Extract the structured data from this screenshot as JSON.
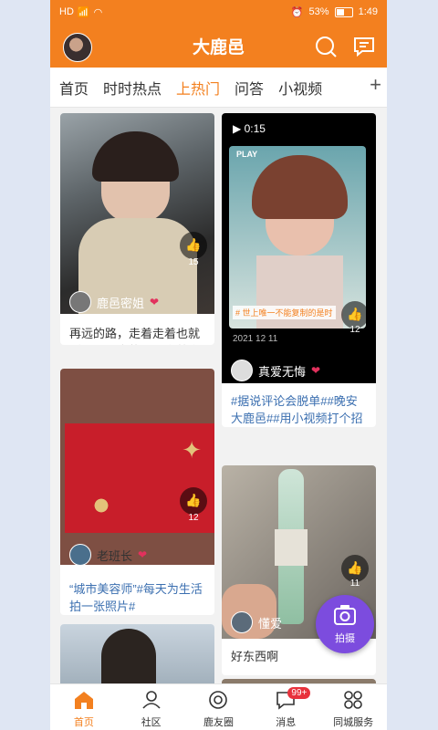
{
  "status": {
    "carrier": "HD",
    "battery": "53%",
    "time": "1:49"
  },
  "app": {
    "title": "大鹿邑"
  },
  "tabs": [
    "首页",
    "时时热点",
    "上热门",
    "问答",
    "小视频"
  ],
  "feed": {
    "left": [
      {
        "user": "鹿邑密姐",
        "likes": "15",
        "text": "再远的路，走着走着也就近了；再高的山，爬着爬着也..."
      },
      {
        "user": "老班长",
        "likes": "12",
        "text": "“城市美容师”#每天为生活拍一张照片#"
      }
    ],
    "right": [
      {
        "duration": "0:15",
        "overlay_play": "PLAY",
        "overlay_caption": "# 世上唯一不能复制的是时",
        "date": "2021 12 11",
        "user": "真爱无悔",
        "likes": "12",
        "text": "#据说评论会脱单##晚安大鹿邑##用小视频打个招呼#"
      },
      {
        "user": "懂爱",
        "likes": "11",
        "text": "好东西啊"
      }
    ]
  },
  "fab": {
    "label": "拍摄"
  },
  "bottom_nav": [
    {
      "label": "首页",
      "icon": "home-icon",
      "active": true
    },
    {
      "label": "社区",
      "icon": "community-icon"
    },
    {
      "label": "鹿友圈",
      "icon": "circle-icon"
    },
    {
      "label": "消息",
      "icon": "message-icon",
      "badge": "99+"
    },
    {
      "label": "同城服务",
      "icon": "grid-icon"
    }
  ],
  "colors": {
    "brand": "#f3801f",
    "fab": "#7c4cde",
    "tag": "#3b6fb0",
    "badge": "#e8323c"
  }
}
